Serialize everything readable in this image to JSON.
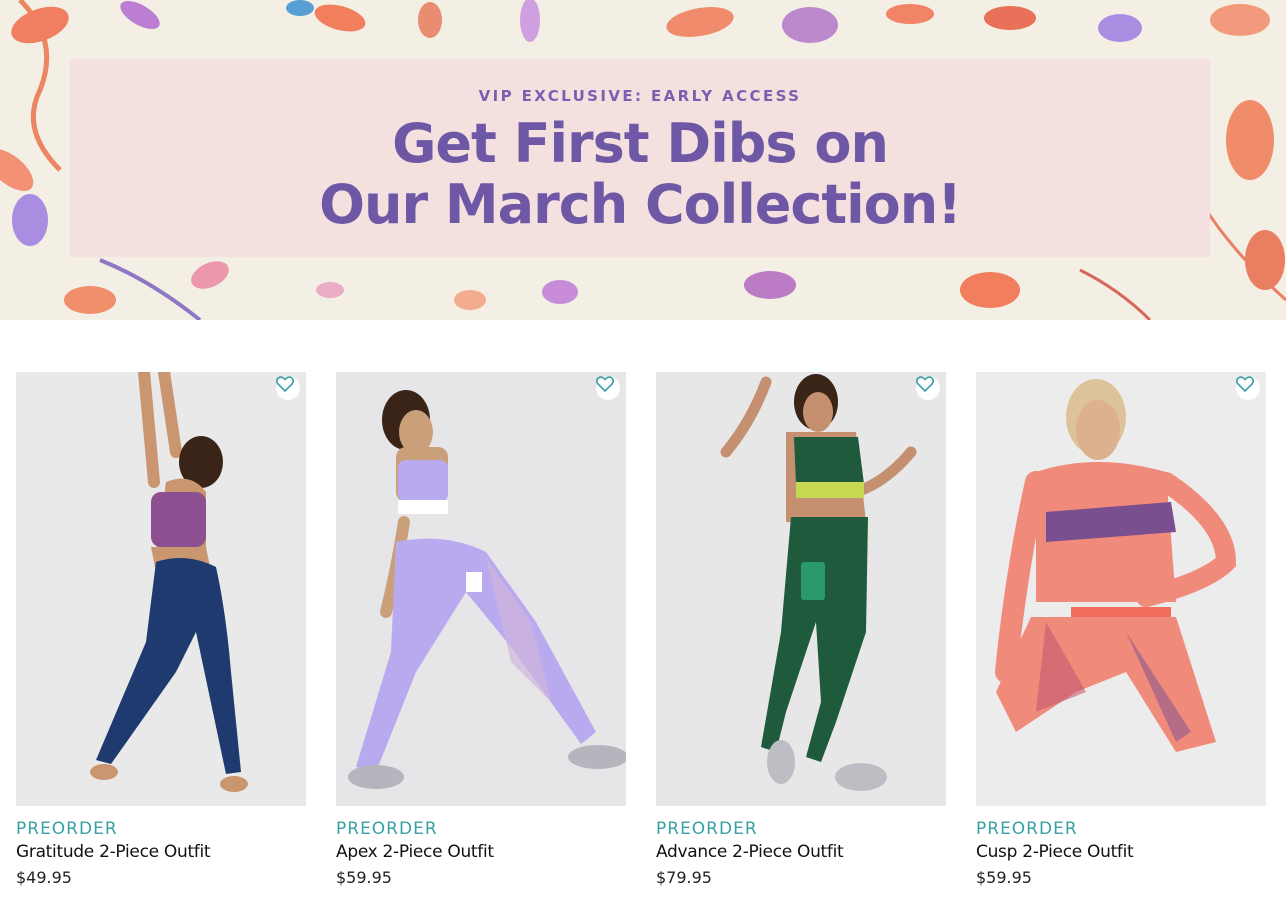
{
  "banner": {
    "eyebrow": "VIP EXCLUSIVE: EARLY ACCESS",
    "title_line1": "Get First Dibs on",
    "title_line2": "Our March Collection!",
    "colors": {
      "title": "#6e58a6",
      "panel": "#f4e0de",
      "background": "#f4efe4"
    }
  },
  "products": [
    {
      "badge": "PREORDER",
      "name": "Gratitude 2-Piece Outfit",
      "price": "$49.95",
      "favorite_icon": "heart-icon",
      "outfit_color": "#1e3a6e"
    },
    {
      "badge": "PREORDER",
      "name": "Apex 2-Piece Outfit",
      "price": "$59.95",
      "favorite_icon": "heart-icon",
      "outfit_color": "#b9a9ef"
    },
    {
      "badge": "PREORDER",
      "name": "Advance 2-Piece Outfit",
      "price": "$79.95",
      "favorite_icon": "heart-icon",
      "outfit_color": "#1f5a3c"
    },
    {
      "badge": "PREORDER",
      "name": "Cusp 2-Piece Outfit",
      "price": "$59.95",
      "favorite_icon": "heart-icon",
      "outfit_color": "#f08a7a"
    }
  ],
  "colors": {
    "badge": "#3aa0a6",
    "heart": "#3aa0a6"
  }
}
